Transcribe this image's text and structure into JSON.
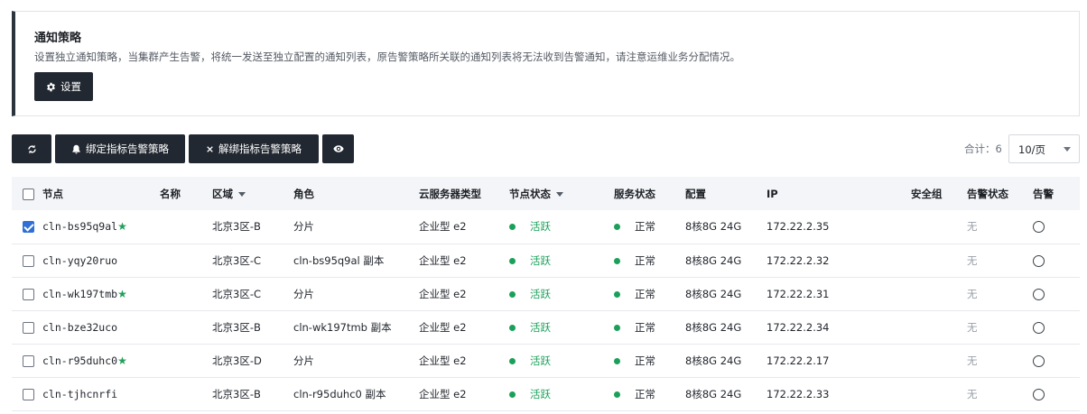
{
  "notice": {
    "title": "通知策略",
    "description": "设置独立通知策略，当集群产生告警，将统一发送至独立配置的通知列表，原告警策略所关联的通知列表将无法收到告警通知，请注意运维业务分配情况。",
    "settings_label": "设置"
  },
  "toolbar": {
    "bind_label": "绑定指标告警策略",
    "unbind_label": "解绑指标告警策略",
    "total": "合计：6",
    "page_size": "10/页"
  },
  "table": {
    "headers": {
      "node": "节点",
      "name": "名称",
      "region": "区域",
      "role": "角色",
      "server_type": "云服务器类型",
      "node_status": "节点状态",
      "service_status": "服务状态",
      "config": "配置",
      "ip": "IP",
      "security_group": "安全组",
      "alarm_status": "告警状态",
      "alarm": "告警"
    },
    "rows": [
      {
        "node": "cln-bs95q9al",
        "primary": true,
        "name": "",
        "region": "北京3区-B",
        "role": "分片",
        "server_type": "企业型 e2",
        "node_status": "活跃",
        "service_status": "正常",
        "config": "8核8G 24G",
        "ip": "172.22.2.35",
        "security_group": "",
        "alarm_status": "无",
        "checked": true
      },
      {
        "node": "cln-yqy20ruo",
        "primary": false,
        "name": "",
        "region": "北京3区-C",
        "role": "cln-bs95q9al 副本",
        "server_type": "企业型 e2",
        "node_status": "活跃",
        "service_status": "正常",
        "config": "8核8G 24G",
        "ip": "172.22.2.32",
        "security_group": "",
        "alarm_status": "无",
        "checked": false
      },
      {
        "node": "cln-wk197tmb",
        "primary": true,
        "name": "",
        "region": "北京3区-C",
        "role": "分片",
        "server_type": "企业型 e2",
        "node_status": "活跃",
        "service_status": "正常",
        "config": "8核8G 24G",
        "ip": "172.22.2.31",
        "security_group": "",
        "alarm_status": "无",
        "checked": false
      },
      {
        "node": "cln-bze32uco",
        "primary": false,
        "name": "",
        "region": "北京3区-B",
        "role": "cln-wk197tmb 副本",
        "server_type": "企业型 e2",
        "node_status": "活跃",
        "service_status": "正常",
        "config": "8核8G 24G",
        "ip": "172.22.2.34",
        "security_group": "",
        "alarm_status": "无",
        "checked": false
      },
      {
        "node": "cln-r95duhc0",
        "primary": true,
        "name": "",
        "region": "北京3区-D",
        "role": "分片",
        "server_type": "企业型 e2",
        "node_status": "活跃",
        "service_status": "正常",
        "config": "8核8G 24G",
        "ip": "172.22.2.17",
        "security_group": "",
        "alarm_status": "无",
        "checked": false
      },
      {
        "node": "cln-tjhcnrfi",
        "primary": false,
        "name": "",
        "region": "北京3区-B",
        "role": "cln-r95duhc0 副本",
        "server_type": "企业型 e2",
        "node_status": "活跃",
        "service_status": "正常",
        "config": "8核8G 24G",
        "ip": "172.22.2.33",
        "security_group": "",
        "alarm_status": "无",
        "checked": false
      }
    ]
  },
  "colors": {
    "accent_dark": "#222831",
    "status_green": "#1aa05a",
    "checkbox_blue": "#2f6fd6"
  }
}
